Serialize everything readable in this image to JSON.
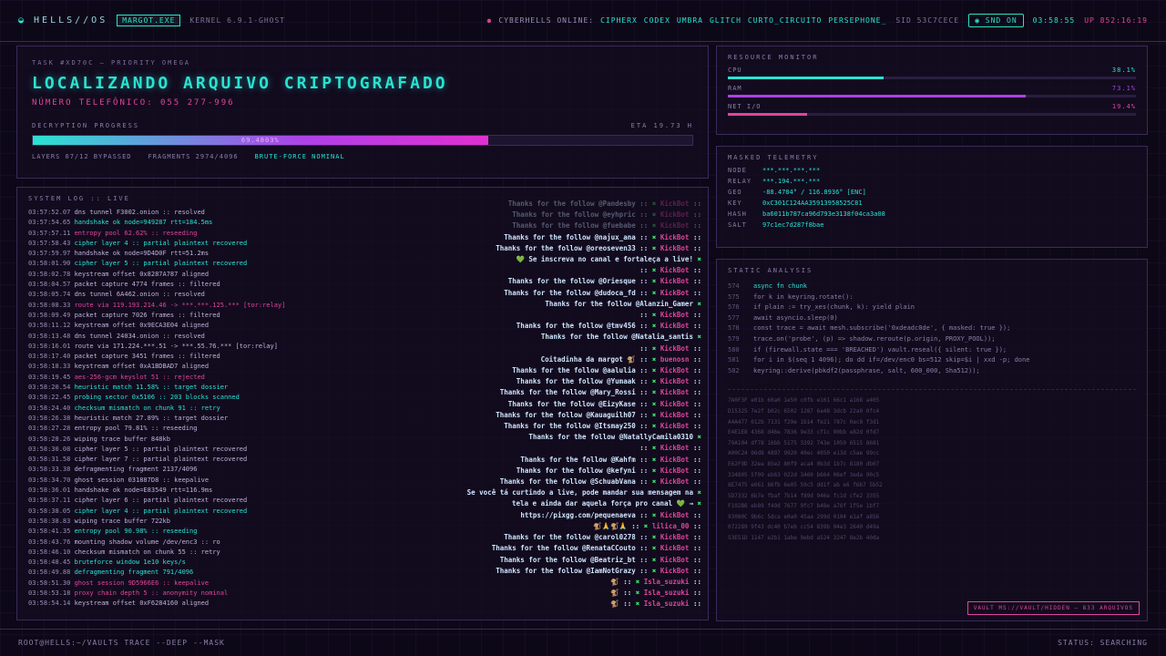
{
  "topbar": {
    "brand": "HELLS//OS",
    "process_chip": "MARGOT.EXE",
    "kernel": "KERNEL 6.9.1-GHOST",
    "online_label": "CYBERHELLS ONLINE:",
    "online_users": [
      "CIPHERX",
      "CODEX",
      "UMBRA",
      "GLITCH",
      "CURTO_CIRCUITO",
      "PERSEPHONE_"
    ],
    "sid": "SID 53C7CECE",
    "snd": "SND ON",
    "clock": "03:58:55",
    "uptime": "UP 852:16:19"
  },
  "task": {
    "id": "TASK #XD70C — PRIORITY OMEGA",
    "title": "LOCALIZANDO ARQUIVO CRIPTOGRAFADO",
    "subtitle": "NÚMERO TELEFÔNICO: 055 277-996",
    "progress_label": "DECRYPTION PROGRESS",
    "eta": "ETA 19.73 H",
    "progress": 0.69,
    "progress_text": "69.4803%",
    "layers": "LAYERS 07/12 BYPASSED",
    "fragments": "FRAGMENTS 2974/4096",
    "status": "BRUTE-FORCE NOMINAL"
  },
  "resources": {
    "title": "RESOURCE MONITOR",
    "items": [
      {
        "label": "CPU",
        "value": "38.1%",
        "fill": 0.381,
        "color": "#29e3d2"
      },
      {
        "label": "RAM",
        "value": "73.1%",
        "fill": 0.731,
        "color": "#b040e8"
      },
      {
        "label": "NET I/O",
        "value": "19.4%",
        "fill": 0.194,
        "color": "#e0459c"
      }
    ]
  },
  "telemetry": {
    "title": "MASKED TELEMETRY",
    "rows": [
      {
        "k": "NODE",
        "v": "***.***.***.***"
      },
      {
        "k": "RELAY",
        "v": "***.194.***.***"
      },
      {
        "k": "GEO",
        "v": "-88.4784° / 116.8936° [ENC]"
      },
      {
        "k": "KEY",
        "v": "0xC301C124AA35913958525C81"
      },
      {
        "k": "HASH",
        "v": "ba6011b787ca96d793e3138f04ca3a08"
      },
      {
        "k": "SALT",
        "v": "97c1ec7d287f8bae"
      }
    ]
  },
  "static": {
    "title": "STATIC ANALYSIS",
    "code": [
      {
        "n": "574",
        "c": "async fn chunk",
        "hl": true
      },
      {
        "n": "575",
        "c": "for k in keyring.rotate():",
        "hl": false
      },
      {
        "n": "576",
        "c": "if plain := try_xes(chunk, k): yield plain",
        "hl": false
      },
      {
        "n": "577",
        "c": "await asyncio.sleep(0)",
        "hl": false
      },
      {
        "n": "578",
        "c": "const trace = await mesh.subscribe('0xdeadc0de', { masked: true });",
        "hl": false
      },
      {
        "n": "579",
        "c": "trace.on('probe', (p) => shadow.reroute(p.origin, PROXY_POOL));",
        "hl": false
      },
      {
        "n": "580",
        "c": "if (firewall.state === 'BREACHED') vault.reseal({ silent: true });",
        "hl": false
      },
      {
        "n": "581",
        "c": "for i in $(seq 1 4096); do dd if=/dev/enc0 bs=512 skip=$i | xxd -p; done",
        "hl": false
      },
      {
        "n": "582",
        "c": "keyring::derive(pbkdf2(passphrase, salt, 600_000, Sha512));",
        "hl": false
      }
    ],
    "hex": [
      "7A0F3F e01b 60a0 1e50 c0fb e161 66c1 a168 a405",
      "D15325 7e2f b02c 6502 1287 6a48 3dcb 22a0 0fc4",
      "A4A477 012b 7131 f29e 1b14 fe21 787c 0ac8 f3d1",
      "E4E1E8 4368 d46e 7836 9e33 cf1c 90bb e82d 0fd7",
      "79A104 df78 16bb 5175 3392 743e 1059 6515 8681",
      "A00C24 06d8 4897 9920 40ec 4050 e13d c5ae 99cc",
      "E62F9D 32ea 85e2 80f9 aca4 0b3d 1b7c 8180 db07",
      "334805 5f09 eb63 022d 3460 b664 06ef 3eda 90c5",
      "8E7475 e061 86fb 6e05 59c5 dd1f ab e6 f6b7 5b52",
      "5D7332 6b7e fbaf 7b14 f89d 946e fc1d cfe2 3355",
      "F102B6 eb89 f49d 7677 9fc7 b48e a76f 1f5e 1bf7",
      "93080C 9b6c 5dca e0a0 45aa 299d 0104 e1af a856",
      "072289 9f43 dc40 b7eb cc54 839b 04e3 2640 d49a",
      "53E51D 1147 e2b1 1abe 9ebd a524 3247 8e2b 40da"
    ],
    "vault": "VAULT MS://VAULT/HIDDEN — 833 ARQUIVOS"
  },
  "log": {
    "title": "SYSTEM LOG :: LIVE",
    "lines": [
      {
        "t": "03:57:52.07",
        "m": "dns tunnel F3002.onion :: resolved",
        "c": "w"
      },
      {
        "t": "03:57:54.65",
        "m": "handshake ok node=949287 rtt=184.5ms",
        "c": "c"
      },
      {
        "t": "03:57:57.11",
        "m": "entropy pool 62.62% :: reseeding",
        "c": "m"
      },
      {
        "t": "03:57:58.43",
        "m": "cipher layer 4 :: partial plaintext recovered",
        "c": "c"
      },
      {
        "t": "03:57:59.97",
        "m": "handshake ok node=9D4D0F rtt=51.2ms",
        "c": "w"
      },
      {
        "t": "03:58:01.90",
        "m": "cipher layer 5 :: partial plaintext recovered",
        "c": "c"
      },
      {
        "t": "03:58:02.78",
        "m": "keystream offset 0x8287A787 aligned",
        "c": "w"
      },
      {
        "t": "03:58:04.57",
        "m": "packet capture 4774 frames :: filtered",
        "c": "w"
      },
      {
        "t": "03:58:05.74",
        "m": "dns tunnel 6A462.onion :: resolved",
        "c": "w"
      },
      {
        "t": "03:58:08.33",
        "m": "route via 119.193.214.46 -> ***.***.125.*** [tor:relay]",
        "c": "m"
      },
      {
        "t": "03:58:09.49",
        "m": "packet capture 7026 frames :: filtered",
        "c": "w"
      },
      {
        "t": "03:58:11.12",
        "m": "keystream offset 0x9ECA3E04 aligned",
        "c": "w"
      },
      {
        "t": "03:58:13.48",
        "m": "dns tunnel 24034.onion :: resolved",
        "c": "w"
      },
      {
        "t": "03:58:16.01",
        "m": "route via 171.224.***.51 -> ***.55.76.*** [tor:relay]",
        "c": "w"
      },
      {
        "t": "03:58:17.40",
        "m": "packet capture 3451 frames :: filtered",
        "c": "w"
      },
      {
        "t": "03:58:18.33",
        "m": "keystream offset 0xA1BDBAD7 aligned",
        "c": "w"
      },
      {
        "t": "03:58:19.45",
        "m": "aes-256-gcm keyslot 51 :: rejected",
        "c": "m"
      },
      {
        "t": "03:58:20.54",
        "m": "heuristic match 11.58% :: target dossier",
        "c": "c"
      },
      {
        "t": "03:58:22.45",
        "m": "probing sector 0x5106 :: 203 blocks scanned",
        "c": "c"
      },
      {
        "t": "03:58:24.40",
        "m": "checksum mismatch on chunk 91 :: retry",
        "c": "c"
      },
      {
        "t": "03:58:26.38",
        "m": "heuristic match 27.89% :: target dossier",
        "c": "w"
      },
      {
        "t": "03:58:27.28",
        "m": "entropy pool 79.81% :: reseeding",
        "c": "w"
      },
      {
        "t": "03:58:28.26",
        "m": "wiping trace buffer 848kb",
        "c": "w"
      },
      {
        "t": "03:58:30.08",
        "m": "cipher layer 5 :: partial plaintext recovered",
        "c": "w"
      },
      {
        "t": "03:58:31.58",
        "m": "cipher layer 7 :: partial plaintext recovered",
        "c": "w"
      },
      {
        "t": "03:58:33.38",
        "m": "defragmenting fragment 2137/4096",
        "c": "w"
      },
      {
        "t": "03:58:34.70",
        "m": "ghost session 031887D8 :: keepalive",
        "c": "w"
      },
      {
        "t": "03:58:36.01",
        "m": "handshake ok node=E83549 rtt=116.9ms",
        "c": "w"
      },
      {
        "t": "03:58:37.11",
        "m": "cipher layer 6 :: partial plaintext recovered",
        "c": "w"
      },
      {
        "t": "03:58:38.05",
        "m": "cipher layer 4 :: partial plaintext recovered",
        "c": "c"
      },
      {
        "t": "03:58:38.83",
        "m": "wiping trace buffer 722kb",
        "c": "w"
      },
      {
        "t": "03:58:41.35",
        "m": "entropy pool 90.98% :: reseeding",
        "c": "c"
      },
      {
        "t": "03:58:43.76",
        "m": "mounting shadow volume /dev/enc3 :: ro",
        "c": "w"
      },
      {
        "t": "03:58:46.10",
        "m": "checksum mismatch on chunk 55 :: retry",
        "c": "w"
      },
      {
        "t": "03:58:48.45",
        "m": "bruteforce window 1e10 keys/s",
        "c": "c"
      },
      {
        "t": "03:58:49.88",
        "m": "defragmenting fragment 791/4096",
        "c": "c"
      },
      {
        "t": "03:58:51.30",
        "m": "ghost session 9D5966E6 :: keepalive",
        "c": "m"
      },
      {
        "t": "03:58:53.18",
        "m": "proxy chain depth 5 :: anonymity nominal",
        "c": "m"
      },
      {
        "t": "03:58:54.14",
        "m": "keystream offset 0xF6284160 aligned",
        "c": "w"
      }
    ]
  },
  "chat": [
    {
      "text": "Thanks for the follow @Pandesby",
      "user": "KickBot",
      "fade": true
    },
    {
      "text": "Thanks for the follow @eyhpric",
      "user": "KickBot",
      "fade": true
    },
    {
      "text": "Thanks for the follow @fuebabe",
      "user": "KickBot",
      "fade": true
    },
    {
      "text": "Thanks for the follow @najux_ana",
      "user": "KickBot",
      "fade": false
    },
    {
      "text": "Thanks for the follow @oreoseven33",
      "user": "KickBot",
      "fade": false
    },
    {
      "text": "💚 Se inscreva no canal e fortaleça a live!",
      "user": "",
      "fade": false
    },
    {
      "text": "",
      "user": "KickBot",
      "fade": false
    },
    {
      "text": "Thanks for the follow @Oriesque",
      "user": "KickBot",
      "fade": false
    },
    {
      "text": "Thanks for the follow @dudoca_fd",
      "user": "KickBot",
      "fade": false
    },
    {
      "text": "Thanks for the follow @Alanzin_Gamer",
      "user": "",
      "fade": false
    },
    {
      "text": "",
      "user": "KickBot",
      "fade": false
    },
    {
      "text": "Thanks for the follow @tmv456",
      "user": "KickBot",
      "fade": false
    },
    {
      "text": "Thanks for the follow @Natalia_santis",
      "user": "",
      "fade": false
    },
    {
      "text": "",
      "user": "KickBot",
      "fade": false
    },
    {
      "text": "Coitadinha da margot 🐒",
      "user": "buenosn",
      "fade": false
    },
    {
      "text": "Thanks for the follow @aalulia",
      "user": "KickBot",
      "fade": false
    },
    {
      "text": "Thanks for the follow @Yumaak",
      "user": "KickBot",
      "fade": false
    },
    {
      "text": "Thanks for the follow @Mary_Rossi",
      "user": "KickBot",
      "fade": false
    },
    {
      "text": "Thanks for the follow @EizyKase",
      "user": "KickBot",
      "fade": false
    },
    {
      "text": "Thanks for the follow @Kauaguilh07",
      "user": "KickBot",
      "fade": false
    },
    {
      "text": "Thanks for the follow @Itsmay250",
      "user": "KickBot",
      "fade": false
    },
    {
      "text": "Thanks for the follow @NatallyCamila0310",
      "user": "",
      "fade": false
    },
    {
      "text": "",
      "user": "KickBot",
      "fade": false
    },
    {
      "text": "Thanks for the follow @Kahfm",
      "user": "KickBot",
      "fade": false
    },
    {
      "text": "Thanks for the follow @kefyni",
      "user": "KickBot",
      "fade": false
    },
    {
      "text": "Thanks for the follow @SchuabVana",
      "user": "KickBot",
      "fade": false
    },
    {
      "text": "Se você tá curtindo a live, pode mandar sua mensagem na",
      "user": "",
      "fade": false
    },
    {
      "text": "tela e ainda dar aquela força pro canal 💚 →",
      "user": "",
      "fade": false
    },
    {
      "text": "https://pixgg.com/pequenaeva",
      "user": "KickBot",
      "fade": false
    },
    {
      "text": "🐒🙏🐒🙏",
      "user": "lilica_00",
      "fade": false
    },
    {
      "text": "Thanks for the follow @carol0278",
      "user": "KickBot",
      "fade": false
    },
    {
      "text": "Thanks for the follow @RenataCCouto",
      "user": "KickBot",
      "fade": false
    },
    {
      "text": "Thanks for the follow @Beatriz_bt",
      "user": "KickBot",
      "fade": false
    },
    {
      "text": "Thanks for the follow @IamNotGrazy",
      "user": "KickBot",
      "fade": false
    },
    {
      "text": "🐒",
      "user": "Isla_suzuki",
      "fade": false
    },
    {
      "text": "🐒",
      "user": "Isla_suzuki",
      "fade": false
    },
    {
      "text": "🐒",
      "user": "Isla_suzuki",
      "fade": false
    }
  ],
  "bottombar": {
    "command": "ROOT@HELLS:~/VAULTS TRACE --DEEP --MASK",
    "status": "STATUS: SEARCHING"
  }
}
